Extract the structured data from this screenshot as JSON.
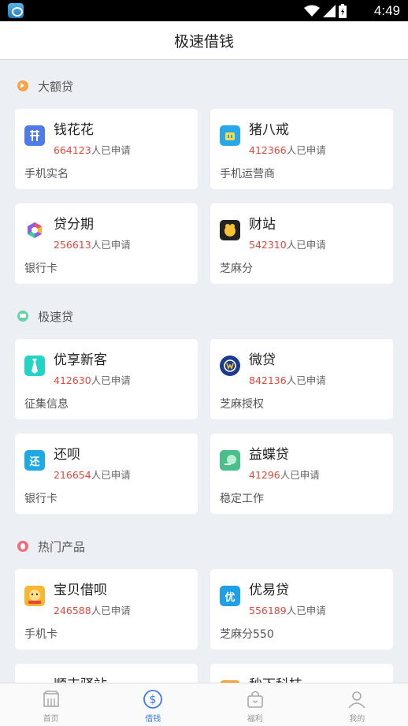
{
  "status_bar": {
    "time": "4:49"
  },
  "header": {
    "title": "极速借钱"
  },
  "sections": [
    {
      "title": "大额贷",
      "icon": "orange-tag-icon",
      "cards": [
        {
          "name": "钱花花",
          "count": "664123",
          "suffix": "人已申请",
          "requirement": "手机实名",
          "logo": "qianhuahua-logo",
          "logo_color": "#4f7be8",
          "logo_text": "花"
        },
        {
          "name": "猪八戒",
          "count": "412366",
          "suffix": "人已申请",
          "requirement": "手机运营商",
          "logo": "zhubajie-logo",
          "logo_color": "#27a8e8",
          "logo_text": ""
        },
        {
          "name": "贷分期",
          "count": "256613",
          "suffix": "人已申请",
          "requirement": "银行卡",
          "logo": "daifenqi-logo",
          "logo_color": "#ffffff",
          "logo_text": ""
        },
        {
          "name": "财站",
          "count": "542310",
          "suffix": "人已申请",
          "requirement": "芝麻分",
          "logo": "caizhan-logo",
          "logo_color": "#222222",
          "logo_text": ""
        }
      ]
    },
    {
      "title": "极速贷",
      "icon": "green-robot-icon",
      "cards": [
        {
          "name": "优享新客",
          "count": "412630",
          "suffix": "人已申请",
          "requirement": "征集信息",
          "logo": "youxiangxinke-logo",
          "logo_color": "#22d3c6",
          "logo_text": ""
        },
        {
          "name": "微贷",
          "count": "842136",
          "suffix": "人已申请",
          "requirement": "芝麻授权",
          "logo": "weidai-logo",
          "logo_color": "#1c3b8c",
          "logo_text": ""
        },
        {
          "name": "还呗",
          "count": "216654",
          "suffix": "人已申请",
          "requirement": "银行卡",
          "logo": "huanbei-logo",
          "logo_color": "#1fa9e3",
          "logo_text": "还"
        },
        {
          "name": "益蝶贷",
          "count": "41296",
          "suffix": "人已申请",
          "requirement": "稳定工作",
          "logo": "yidiedai-logo",
          "logo_color": "#4bbf8a",
          "logo_text": ""
        }
      ]
    },
    {
      "title": "热门产品",
      "icon": "red-fire-icon",
      "cards": [
        {
          "name": "宝贝借呗",
          "count": "246588",
          "suffix": "人已申请",
          "requirement": "手机卡",
          "logo": "baobeijiebei-logo",
          "logo_color": "#f7b733",
          "logo_text": ""
        },
        {
          "name": "优易贷",
          "count": "556189",
          "suffix": "人已申请",
          "requirement": "芝麻分550",
          "logo": "youyidai-logo",
          "logo_color": "#1e9fe6",
          "logo_text": "优"
        },
        {
          "name": "顺丰驿站",
          "count": "",
          "suffix": "",
          "requirement": "",
          "logo": "shunfeng-logo",
          "logo_color": "#ffffff",
          "logo_text": ""
        },
        {
          "name": "秒下科技",
          "count": "",
          "suffix": "",
          "requirement": "",
          "logo": "miaoxia-logo",
          "logo_color": "#f3a33c",
          "logo_text": ""
        }
      ]
    }
  ],
  "tabbar": {
    "items": [
      {
        "label": "首页",
        "icon": "home-icon",
        "active": false
      },
      {
        "label": "借钱",
        "icon": "dollar-icon",
        "active": true
      },
      {
        "label": "福利",
        "icon": "gift-bag-icon",
        "active": false
      },
      {
        "label": "我的",
        "icon": "user-icon",
        "active": false
      }
    ],
    "active_color": "#3d7be0",
    "inactive_color": "#999999"
  }
}
